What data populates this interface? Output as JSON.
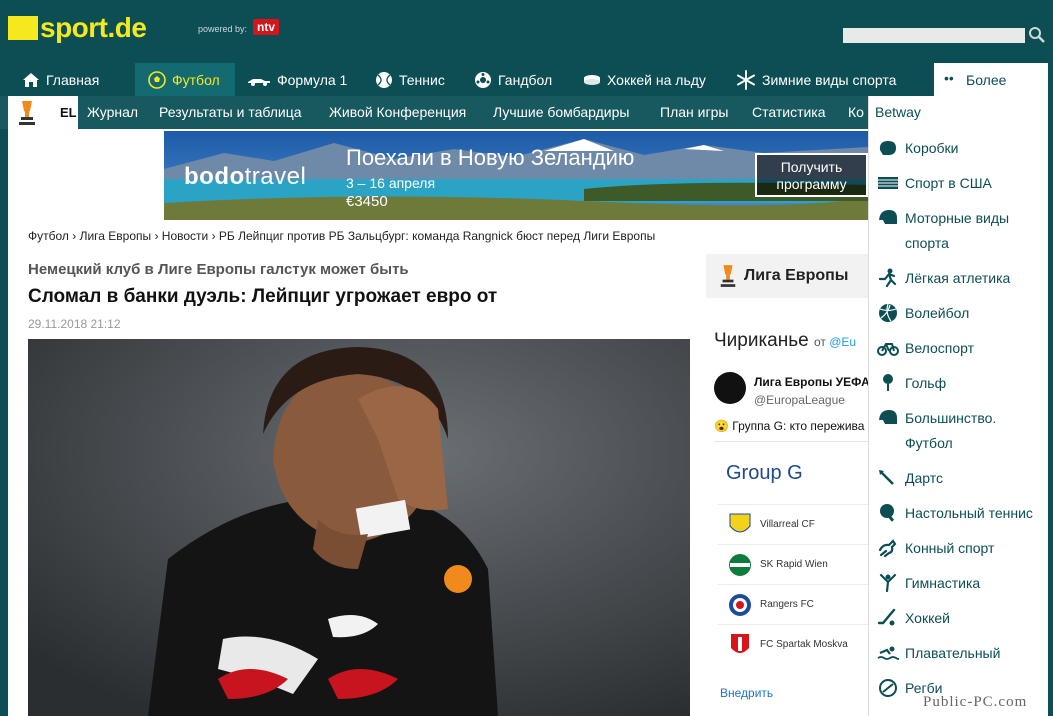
{
  "header": {
    "logo_text": "sport.de",
    "powered_by": "powered by:",
    "partner": "ntv",
    "search_placeholder": ""
  },
  "main_nav": [
    {
      "label": "Главная",
      "icon": "home-icon"
    },
    {
      "label": "Футбол",
      "icon": "football-icon",
      "active": true
    },
    {
      "label": "Формула 1",
      "icon": "formula1-icon"
    },
    {
      "label": "Теннис",
      "icon": "tennis-icon"
    },
    {
      "label": "Гандбол",
      "icon": "handball-icon"
    },
    {
      "label": "Хоккей на льду",
      "icon": "ice-hockey-icon"
    },
    {
      "label": "Зимние виды спорта",
      "icon": "snowflake-icon"
    },
    {
      "label": "Более",
      "icon": "dots-icon"
    }
  ],
  "sub_nav": {
    "badge": "EL",
    "items": [
      "Журнал",
      "Результаты и таблица",
      "Живой Конференция",
      "Лучшие бомбардиры",
      "План игры",
      "Статистика",
      "Ко"
    ]
  },
  "banner": {
    "brand_a": "bodo",
    "brand_b": "travel",
    "title": "Поехали в Новую Зеландию",
    "dates": "3 – 16 апреля",
    "price": "€3450",
    "cta_line1": "Получить",
    "cta_line2": "программу"
  },
  "breadcrumb": "Футбол › Лига Европы › Новости › РБ Лейпциг против РБ Зальцбург: команда Rangnick бюст перед Лиги Европы",
  "article": {
    "subtitle": "Немецкий клуб в Лиге Европы галстук может быть",
    "headline": "Сломал в банки дуэль: Лейпциг угрожает евро от",
    "date": "29.11.2018 21:12"
  },
  "sidebar": {
    "competition": "Лига Европы",
    "twitter_title": "Чириканье",
    "twitter_by": "от",
    "twitter_by_handle": "@Eu",
    "tweet_name": "Лига Европы УЕФА",
    "tweet_handle": "@EuropaLeague",
    "tweet_text": "Группа G: кто пережива",
    "group_title": "Group G",
    "teams": [
      "Villarreal CF",
      "SK Rapid Wien",
      "Rangers FC",
      "FC Spartak Moskva"
    ],
    "embed": "Внедрить"
  },
  "more_menu": [
    {
      "label": "Betway",
      "icon": ""
    },
    {
      "label": "Коробки",
      "icon": "boxing-icon"
    },
    {
      "label": "Спорт в США",
      "icon": "us-flag-icon"
    },
    {
      "label": "Моторные виды спорта",
      "icon": "helmet-icon"
    },
    {
      "label": "Лёгкая атлетика",
      "icon": "runner-icon"
    },
    {
      "label": "Волейбол",
      "icon": "volleyball-icon"
    },
    {
      "label": "Велоспорт",
      "icon": "bicycle-icon"
    },
    {
      "label": "Гольф",
      "icon": "golf-icon"
    },
    {
      "label": "Большинство. Футбол",
      "icon": "helmet-icon"
    },
    {
      "label": "Дартс",
      "icon": "dart-icon"
    },
    {
      "label": "Настольный теннис",
      "icon": "table-tennis-icon"
    },
    {
      "label": "Конный спорт",
      "icon": "equestrian-icon"
    },
    {
      "label": "Гимнастика",
      "icon": "gymnastics-icon"
    },
    {
      "label": "Хоккей",
      "icon": "hockey-icon"
    },
    {
      "label": "Плавательный",
      "icon": "swimming-icon"
    },
    {
      "label": "Регби",
      "icon": "rugby-icon"
    }
  ],
  "watermark": "Public-PC.com",
  "colors": {
    "brand_teal": "#0d4e55",
    "accent_yellow": "#f5e81c",
    "partner_red": "#d7141a"
  }
}
